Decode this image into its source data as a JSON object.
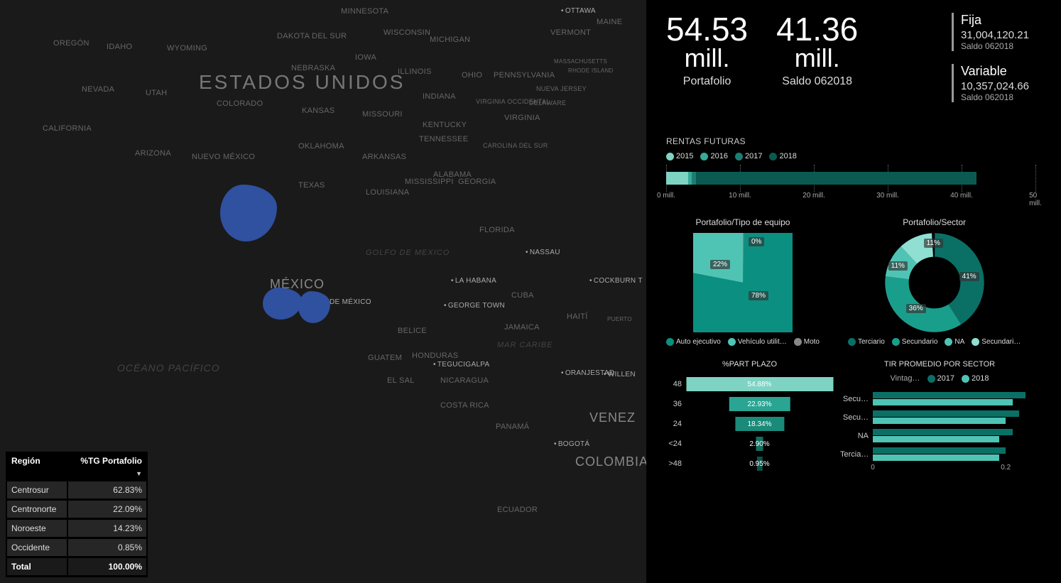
{
  "map": {
    "big_country": "ESTADOS UNIDOS",
    "mexico": "MÉXICO",
    "ocean_pacifico": "Océano Pacífico",
    "golfo": "Golfo de Mexico",
    "caribe": "Mar Caribe",
    "states": [
      "MINNESOTA",
      "WISCONSIN",
      "MICHIGAN",
      "VERMONT",
      "MAINE",
      "OREGÓN",
      "IDAHO",
      "WYOMING",
      "DAKOTA DEL SUR",
      "NEBRASKA",
      "IOWA",
      "ILLINOIS",
      "OHIO",
      "PENNSYLVANIA",
      "MASSACHUSETTS",
      "RHODE ISLAND",
      "NEVADA",
      "UTAH",
      "COLORADO",
      "KANSAS",
      "MISSOURI",
      "INDIANA",
      "VIRGINIA OCCIDENTAL",
      "VIRGINIA",
      "DELAWARE",
      "NUEVA JERSEY",
      "CALIFORNIA",
      "ARIZONA",
      "NUEVO MÉXICO",
      "OKLAHOMA",
      "ARKANSAS",
      "TENNESSEE",
      "KENTUCKY",
      "CAROLINA DEL SUR",
      "TEXAS",
      "LOUISIANA",
      "MISSISSIPPI",
      "ALABAMA",
      "GEORGIA",
      "FLORIDA"
    ],
    "countries": [
      "BELICE",
      "GUATEM",
      "HONDURAS",
      "EL SAL",
      "NICARAGUA",
      "COSTA RICA",
      "PANAMÁ",
      "COLOMBIA",
      "ECUADOR",
      "VENEZ",
      "CUBA",
      "JAMAICA",
      "HAITÍ",
      "PUERTO"
    ],
    "cities": [
      "Ottawa",
      "Ciudad de México",
      "La Habana",
      "George Town",
      "Tegucigalpa",
      "Nassau",
      "Cockburn T",
      "Oranjestad",
      "Willen",
      "Bogotá"
    ]
  },
  "region_table": {
    "col1": "Región",
    "col2": "%TG Portafolio",
    "sort_icon": "▼",
    "rows": [
      {
        "region": "Centrosur",
        "pct": "62.83%"
      },
      {
        "region": "Centronorte",
        "pct": "22.09%"
      },
      {
        "region": "Noroeste",
        "pct": "14.23%"
      },
      {
        "region": "Occidente",
        "pct": "0.85%"
      }
    ],
    "total_label": "Total",
    "total_pct": "100.00%"
  },
  "kpi": {
    "portafolio": {
      "value": "54.53",
      "unit": "mill.",
      "label": "Portafolio"
    },
    "saldo": {
      "value": "41.36",
      "unit": "mill.",
      "label": "Saldo 062018"
    },
    "fija": {
      "title": "Fija",
      "value": "31,004,120.21",
      "sub": "Saldo 062018"
    },
    "variable": {
      "title": "Variable",
      "value": "10,357,024.66",
      "sub": "Saldo 062018"
    }
  },
  "rentas": {
    "title": "RENTAS FUTURAS",
    "legend": [
      "2015",
      "2016",
      "2017",
      "2018"
    ],
    "axis": [
      "0 mill.",
      "10 mill.",
      "20 mill.",
      "30 mill.",
      "40 mill.",
      "50 mill."
    ]
  },
  "donut_equipo": {
    "title": "Portafolio/Tipo de equipo",
    "legend": [
      "Auto ejecutivo",
      "Vehículo utilit…",
      "Moto"
    ]
  },
  "donut_sector": {
    "title": "Portafolio/Sector",
    "legend": [
      "Terciario",
      "Secundario",
      "NA",
      "Secundari…"
    ]
  },
  "funnel": {
    "title": "%PART PLAZO",
    "rows": [
      {
        "cat": "48",
        "pct": "54.88%"
      },
      {
        "cat": "36",
        "pct": "22.93%"
      },
      {
        "cat": "24",
        "pct": "18.34%"
      },
      {
        "cat": "<24",
        "pct": "2.90%"
      },
      {
        "cat": ">48",
        "pct": "0.95%"
      }
    ]
  },
  "tir": {
    "title": "TIR PROMEDIO POR SECTOR",
    "vintage": "Vintag…",
    "legend": [
      "2017",
      "2018"
    ],
    "rows": [
      "Secu…",
      "Secu…",
      "NA",
      "Tercia…"
    ],
    "axis": [
      "0",
      "0.2"
    ]
  },
  "chart_data": [
    {
      "type": "stacked_bar_horizontal",
      "title": "RENTAS FUTURAS",
      "xlabel": "mill.",
      "xlim": [
        0,
        50
      ],
      "series": [
        {
          "name": "2015",
          "value": 3
        },
        {
          "name": "2016",
          "value": 0.5
        },
        {
          "name": "2017",
          "value": 0.5
        },
        {
          "name": "2018",
          "value": 38
        }
      ]
    },
    {
      "type": "pie",
      "title": "Portafolio/Tipo de equipo",
      "data": [
        {
          "name": "Auto ejecutivo",
          "value": 78,
          "label": "78%"
        },
        {
          "name": "Vehículo utilitario",
          "value": 22,
          "label": "22%"
        },
        {
          "name": "Moto",
          "value": 0,
          "label": "0%"
        }
      ]
    },
    {
      "type": "donut",
      "title": "Portafolio/Sector",
      "data": [
        {
          "name": "Terciario",
          "value": 41,
          "label": "41%"
        },
        {
          "name": "Secundario",
          "value": 36,
          "label": "36%"
        },
        {
          "name": "NA",
          "value": 11,
          "label": "11%"
        },
        {
          "name": "Secundario Manufactura",
          "value": 11,
          "label": "11%"
        }
      ]
    },
    {
      "type": "funnel",
      "title": "%PART PLAZO",
      "data": [
        {
          "cat": "48",
          "value": 54.88
        },
        {
          "cat": "36",
          "value": 22.93
        },
        {
          "cat": "24",
          "value": 18.34
        },
        {
          "cat": "<24",
          "value": 2.9
        },
        {
          "cat": ">48",
          "value": 0.95
        }
      ]
    },
    {
      "type": "bar",
      "title": "TIR PROMEDIO POR SECTOR",
      "categories": [
        "Secundario",
        "Secundario Manufactura",
        "NA",
        "Terciario"
      ],
      "xlim": [
        0,
        0.25
      ],
      "series": [
        {
          "name": "2017",
          "values": [
            0.23,
            0.22,
            0.21,
            0.2
          ]
        },
        {
          "name": "2018",
          "values": [
            0.21,
            0.2,
            0.19,
            0.19
          ]
        }
      ]
    },
    {
      "type": "table",
      "title": "%TG Portafolio por Región",
      "columns": [
        "Región",
        "%TG Portafolio"
      ],
      "rows": [
        [
          "Centrosur",
          "62.83%"
        ],
        [
          "Centronorte",
          "22.09%"
        ],
        [
          "Noroeste",
          "14.23%"
        ],
        [
          "Occidente",
          "0.85%"
        ]
      ],
      "total": [
        "Total",
        "100.00%"
      ]
    }
  ]
}
